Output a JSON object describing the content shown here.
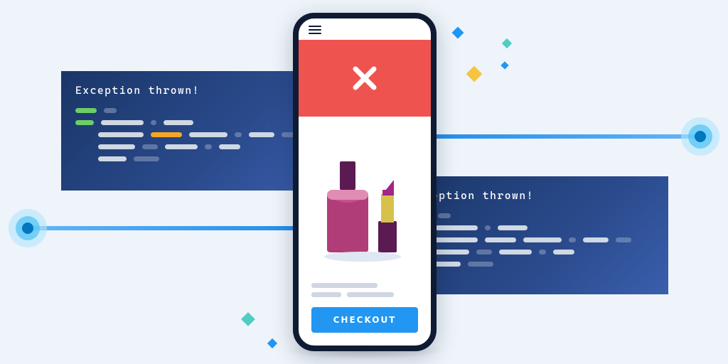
{
  "colors": {
    "bg": "#eef4fa",
    "panel_gradient_from": "#1a3668",
    "panel_gradient_to": "#3a5fad",
    "error": "#ef5350",
    "primary": "#2196f3",
    "phone_frame": "#0f1b33",
    "accent_green": "#6bcf63",
    "accent_orange": "#f5a623"
  },
  "left_panel": {
    "title": "Exception thrown!"
  },
  "right_panel": {
    "title": "Exception thrown!"
  },
  "phone": {
    "checkout_label": "CHECKOUT"
  }
}
